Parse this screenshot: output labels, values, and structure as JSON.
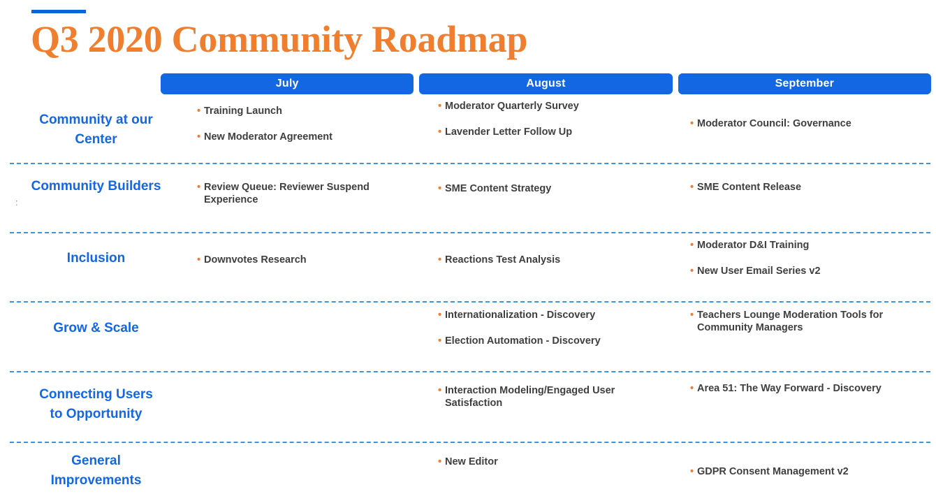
{
  "header": {
    "accent_color": "#0d63de",
    "title": "Q3 2020 Community Roadmap",
    "title_color": "#ef7f2e"
  },
  "months": [
    {
      "label": "July"
    },
    {
      "label": "August"
    },
    {
      "label": "September"
    }
  ],
  "theme": {
    "pill_color": "#1367e3",
    "row_label_color": "#1367e3",
    "bullet_color": "#ef7f2e",
    "item_text_color": "#3f3f3f",
    "divider_color": "#3f94d8"
  },
  "artifacts": {
    "stray_mark": ":"
  },
  "rows": [
    {
      "label": "Community at our Center",
      "label_lines": [
        "Community at our",
        "Center"
      ],
      "july": [
        {
          "text": "Training Launch"
        },
        {
          "text": "New Moderator Agreement"
        }
      ],
      "august": [
        {
          "text": "Moderator Quarterly Survey"
        },
        {
          "text": "Lavender Letter Follow Up"
        }
      ],
      "september": [
        {
          "text": "Moderator Council: Governance"
        }
      ]
    },
    {
      "label": "Community Builders",
      "label_lines": [
        "Community Builders"
      ],
      "july": [
        {
          "text": "Review Queue: Reviewer Suspend Experience"
        }
      ],
      "august": [
        {
          "text": "SME Content Strategy"
        }
      ],
      "september": [
        {
          "text": "SME Content Release"
        }
      ]
    },
    {
      "label": "Inclusion",
      "label_lines": [
        "Inclusion"
      ],
      "july": [
        {
          "text": "Downvotes Research"
        }
      ],
      "august": [
        {
          "text": "Reactions Test Analysis"
        }
      ],
      "september": [
        {
          "text": "Moderator D&I Training"
        },
        {
          "text": "New User Email Series v2"
        }
      ]
    },
    {
      "label": "Grow & Scale",
      "label_lines": [
        "Grow & Scale"
      ],
      "july": [],
      "august": [
        {
          "text": "Internationalization - Discovery"
        },
        {
          "text": "Election Automation - Discovery"
        }
      ],
      "september": [
        {
          "text": "Teachers Lounge Moderation Tools for Community Managers"
        }
      ]
    },
    {
      "label": "Connecting Users to Opportunity",
      "label_lines": [
        "Connecting Users",
        "to Opportunity"
      ],
      "july": [],
      "august": [
        {
          "text": "Interaction Modeling/Engaged User Satisfaction"
        }
      ],
      "september": [
        {
          "text": "Area 51: The Way Forward - Discovery"
        }
      ]
    },
    {
      "label": "General Improvements",
      "label_lines": [
        "General",
        "Improvements"
      ],
      "july": [],
      "august": [
        {
          "text": "New Editor"
        }
      ],
      "september": [
        {
          "text": "GDPR Consent Management v2"
        }
      ]
    }
  ]
}
